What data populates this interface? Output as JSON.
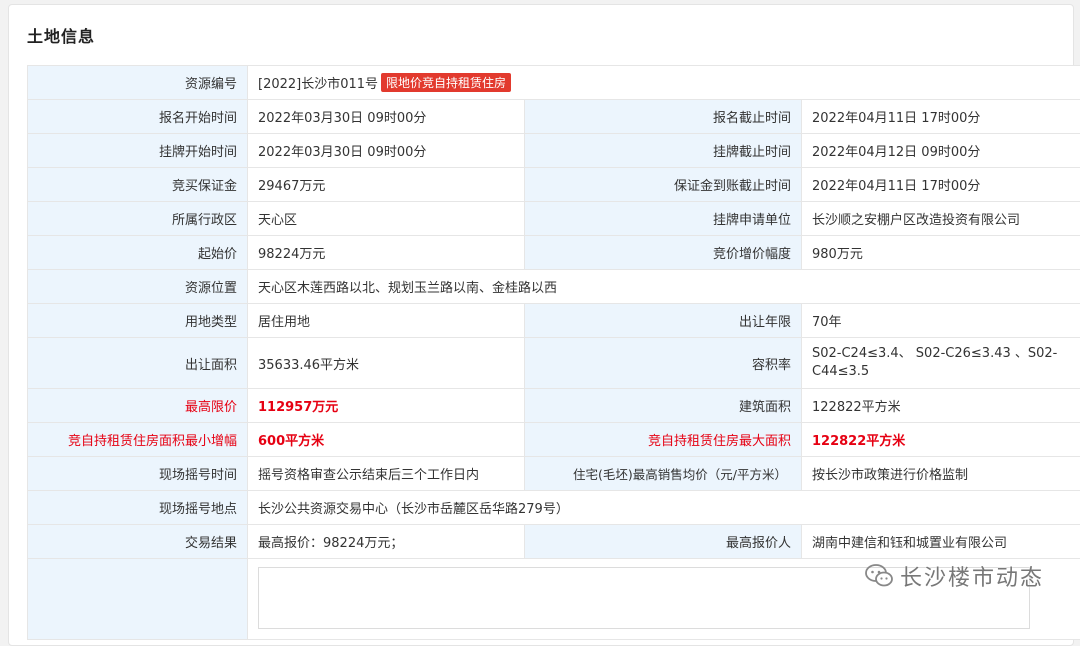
{
  "section_title": "土地信息",
  "rows": {
    "resource_id": {
      "label": "资源编号",
      "value": "[2022]长沙市011号",
      "tag": "限地价竞自持租赁住房"
    },
    "signup_start": {
      "label": "报名开始时间",
      "value": "2022年03月30日 09时00分"
    },
    "signup_end": {
      "label": "报名截止时间",
      "value": "2022年04月11日 17时00分"
    },
    "listing_start": {
      "label": "挂牌开始时间",
      "value": "2022年03月30日 09时00分"
    },
    "listing_end": {
      "label": "挂牌截止时间",
      "value": "2022年04月12日 09时00分"
    },
    "deposit": {
      "label": "竞买保证金",
      "value": "29467万元"
    },
    "deposit_deadline": {
      "label": "保证金到账截止时间",
      "value": "2022年04月11日 17时00分"
    },
    "district": {
      "label": "所属行政区",
      "value": "天心区"
    },
    "applicant_unit": {
      "label": "挂牌申请单位",
      "value": "长沙顺之安棚户区改造投资有限公司"
    },
    "start_price": {
      "label": "起始价",
      "value": "98224万元"
    },
    "increment": {
      "label": "竞价增价幅度",
      "value": "980万元"
    },
    "location": {
      "label": "资源位置",
      "value": "天心区木莲西路以北、规划玉兰路以南、金桂路以西"
    },
    "land_use": {
      "label": "用地类型",
      "value": "居住用地"
    },
    "term": {
      "label": "出让年限",
      "value": "70年"
    },
    "area": {
      "label": "出让面积",
      "value": "35633.46平方米"
    },
    "far": {
      "label": "容积率",
      "value": "S02-C24≤3.4、 S02-C26≤3.43 、S02-C44≤3.5"
    },
    "max_price": {
      "label": "最高限价",
      "value": "112957万元"
    },
    "building_area": {
      "label": "建筑面积",
      "value": "122822平方米"
    },
    "rental_min_inc": {
      "label": "竞自持租赁住房面积最小增幅",
      "value": "600平方米"
    },
    "rental_max_area": {
      "label": "竞自持租赁住房最大面积",
      "value": "122822平方米"
    },
    "lottery_time": {
      "label": "现场摇号时间",
      "value": "摇号资格审查公示结束后三个工作日内"
    },
    "avg_price": {
      "label": "住宅(毛坯)最高销售均价（元/平方米）",
      "value": "按长沙市政策进行价格监制"
    },
    "lottery_place": {
      "label": "现场摇号地点",
      "value": "长沙公共资源交易中心（长沙市岳麓区岳华路279号）"
    },
    "result": {
      "label": "交易结果",
      "value": "最高报价：98224万元；"
    },
    "top_bidder": {
      "label": "最高报价人",
      "value": "湖南中建信和钰和城置业有限公司"
    }
  },
  "watermark": {
    "text": "长沙楼市动态",
    "icon": "wechat-icon"
  }
}
